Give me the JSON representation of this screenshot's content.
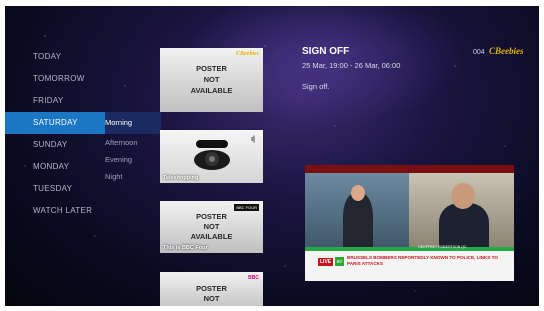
{
  "days": [
    "TODAY",
    "TOMORROW",
    "FRIDAY",
    "SATURDAY",
    "SUNDAY",
    "MONDAY",
    "TUESDAY",
    "WATCH LATER"
  ],
  "selected_day": "SATURDAY",
  "periods": [
    "Morning",
    "Afternoon",
    "Evening",
    "Night"
  ],
  "selected_period": "Morning",
  "cards": [
    {
      "poster_text": [
        "POSTER",
        "NOT",
        "AVAILABLE"
      ],
      "title": "",
      "badge": "CBeebies"
    },
    {
      "poster_text": [],
      "title": "Teleshopping",
      "badge": ""
    },
    {
      "poster_text": [
        "POSTER",
        "NOT",
        "AVAILABLE"
      ],
      "title": "This is BBC Four",
      "badge": "BBC FOUR"
    },
    {
      "poster_text": [
        "POSTER",
        "NOT",
        "AVAILABLE"
      ],
      "title": "",
      "badge": "BBC"
    }
  ],
  "program": {
    "title": "SIGN OFF",
    "time": "25 Mar, 19:00 - 26 Mar, 06:00",
    "description": "Sign off."
  },
  "channel": {
    "number": "004",
    "logo": "CBeebies"
  },
  "video": {
    "live_label": "LIVE",
    "channel_tag": "RT",
    "headline": "BRUSSELS BOMBERS REPORTEDLY KNOWN TO POLICE, LINKS TO PARIS ATTACKS",
    "guest_caption": "GEOFFREY ROBERTSON QC"
  },
  "colors": {
    "selected": "#1b77c6",
    "accent_logo": "#e2b400",
    "live_red": "#c4161c"
  }
}
